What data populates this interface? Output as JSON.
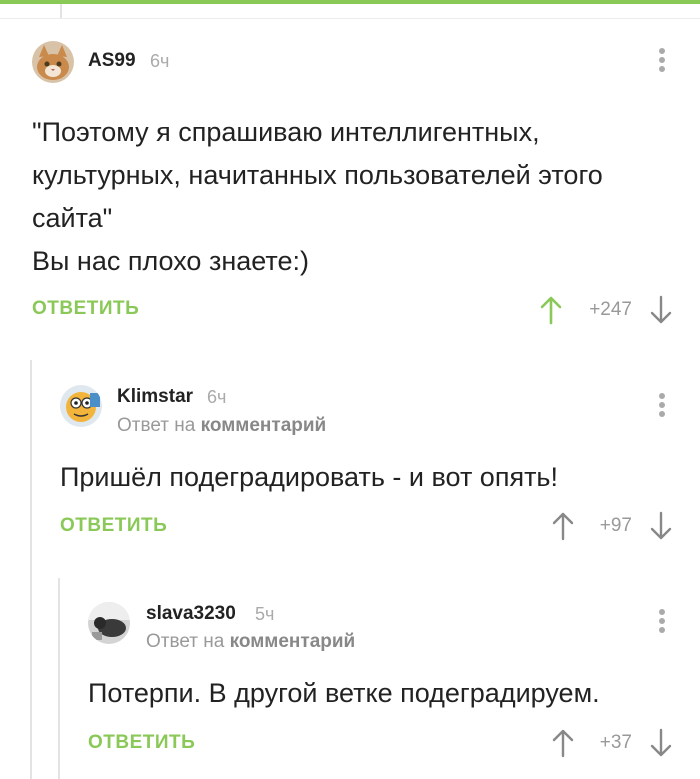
{
  "comments": [
    {
      "author": "AS99",
      "time": "6ч",
      "text_lines": [
        "\"Поэтому я спрашиваю интеллигентных,",
        "культурных, начитанных пользователей этого",
        "сайта\"",
        "Вы нас плохо знаете:)"
      ],
      "reply_label": "ОТВЕТИТЬ",
      "rating": "+247"
    },
    {
      "author": "Klimstar",
      "time": "6ч",
      "reply_prefix": "Ответ на",
      "reply_link": "комментарий",
      "text_lines": [
        "Пришёл подеградировать - и вот опять!"
      ],
      "reply_label": "ОТВЕТИТЬ",
      "rating": "+97"
    },
    {
      "author": "slava3230",
      "time": "5ч",
      "reply_prefix": "Ответ на",
      "reply_link": "комментарий",
      "text_lines": [
        "Потерпи. В другой ветке подеградируем."
      ],
      "reply_label": "ОТВЕТИТЬ",
      "rating": "+37"
    }
  ],
  "colors": {
    "accent_green": "#8ac858",
    "muted_text": "#999999",
    "thread_line": "#e3e3e3"
  },
  "icons": [
    "more-vertical-icon",
    "upvote-arrow-icon",
    "downvote-arrow-icon"
  ]
}
